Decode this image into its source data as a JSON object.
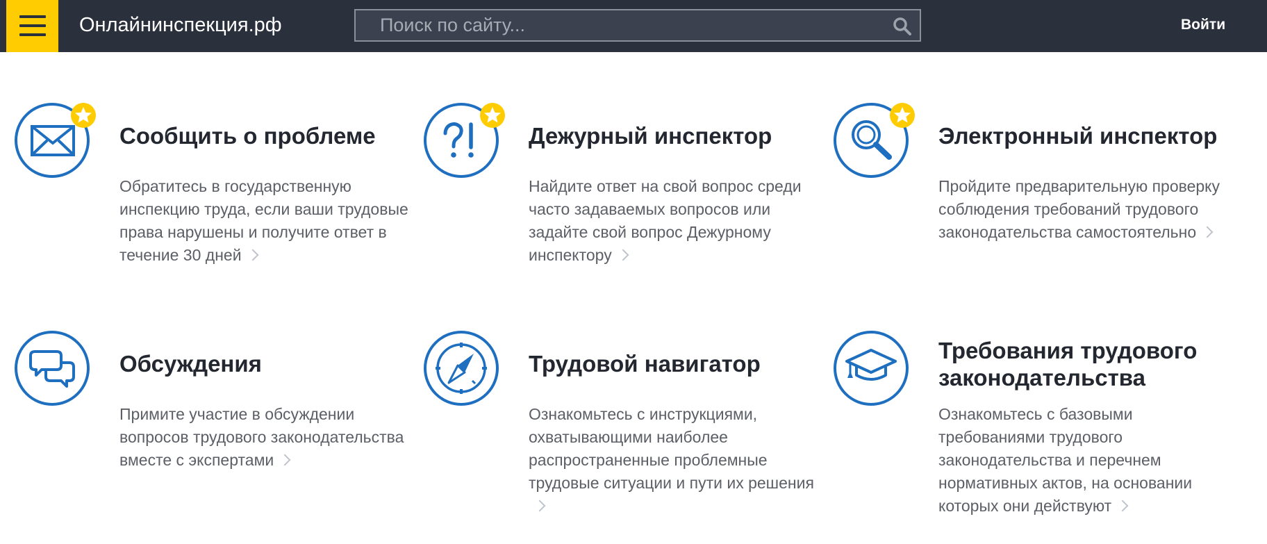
{
  "header": {
    "menu_icon": "hamburger-icon",
    "site_title": "Онлайнинспекция.рф",
    "search": {
      "placeholder": "Поиск по сайту...",
      "value": "",
      "icon": "search-icon"
    },
    "login_label": "Войти",
    "colors": {
      "bar": "#2b303d",
      "accent": "#fecc00",
      "search_bg": "#3c4150"
    }
  },
  "cards": [
    {
      "icon": "envelope-icon",
      "featured": true,
      "title": "Сообщить о проблеме",
      "description": "Обратитесь в государственную инспекцию труда, если ваши трудовые права нарушены и получите ответ в течение 30 дней"
    },
    {
      "icon": "question-exclamation-icon",
      "featured": true,
      "title": "Дежурный инспектор",
      "description": "Найдите ответ на свой вопрос среди часто задаваемых вопросов или задайте свой вопрос Дежурному инспектору"
    },
    {
      "icon": "magnifier-icon",
      "featured": true,
      "title": "Электронный инспектор",
      "description": "Пройдите предварительную проверку соблюдения требований трудового законодательства самостоятельно"
    },
    {
      "icon": "chat-bubbles-icon",
      "featured": false,
      "title": "Обсуждения",
      "description": "Примите участие в обсуждении вопросов трудового законодательства вместе с экспертами"
    },
    {
      "icon": "compass-icon",
      "featured": false,
      "title": "Трудовой навигатор",
      "description": "Ознакомьтесь с инструкциями, охватывающими наиболее распространенные проблемные трудовые ситуации и пути их решения"
    },
    {
      "icon": "graduation-cap-icon",
      "featured": false,
      "title": "Требования трудового законодательства",
      "description": "Ознакомьтесь с базовыми требованиями трудового законодательства и перечнем нормативных актов, на основании которых они действуют"
    }
  ],
  "colors": {
    "icon_blue": "#1f6fc0",
    "star_yellow": "#fecc00",
    "title_text": "#23272f",
    "desc_text": "#5c5f66",
    "chevron": "#bfc3cb"
  }
}
